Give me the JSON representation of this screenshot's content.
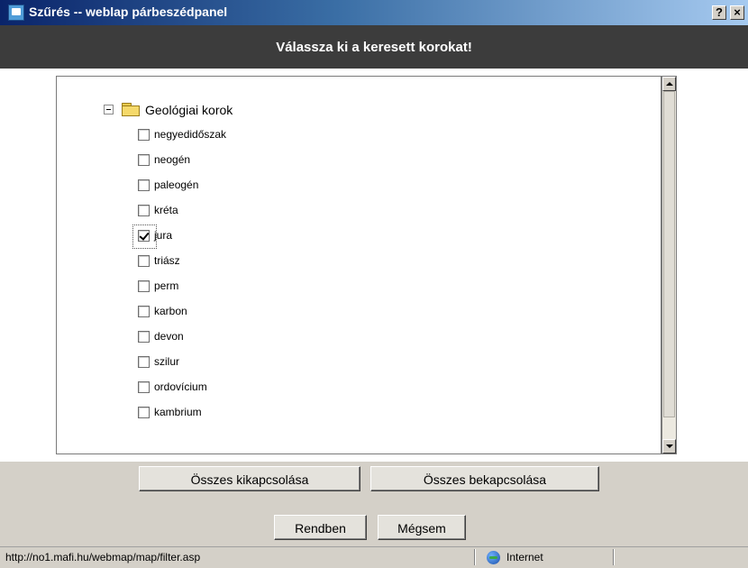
{
  "window": {
    "title": "Szűrés -- weblap párbeszédpanel",
    "help_button": "?",
    "close_button": "×"
  },
  "header": {
    "prompt": "Válassza ki a keresett korokat!"
  },
  "tree": {
    "root_label": "Geológiai korok",
    "root_expanded": true,
    "items": [
      {
        "label": "negyedidőszak",
        "checked": false
      },
      {
        "label": "neogén",
        "checked": false
      },
      {
        "label": "paleogén",
        "checked": false
      },
      {
        "label": "kréta",
        "checked": false
      },
      {
        "label": "jura",
        "checked": true,
        "focused": true
      },
      {
        "label": "triász",
        "checked": false
      },
      {
        "label": "perm",
        "checked": false
      },
      {
        "label": "karbon",
        "checked": false
      },
      {
        "label": "devon",
        "checked": false
      },
      {
        "label": "szilur",
        "checked": false
      },
      {
        "label": "ordovícium",
        "checked": false
      },
      {
        "label": "kambrium",
        "checked": false
      }
    ]
  },
  "buttons": {
    "deselect_all": "Összes kikapcsolása",
    "select_all": "Összes bekapcsolása",
    "ok": "Rendben",
    "cancel": "Mégsem"
  },
  "statusbar": {
    "url": "http://no1.mafi.hu/webmap/map/filter.asp",
    "zone": "Internet",
    "zone_icon": "globe-icon"
  }
}
